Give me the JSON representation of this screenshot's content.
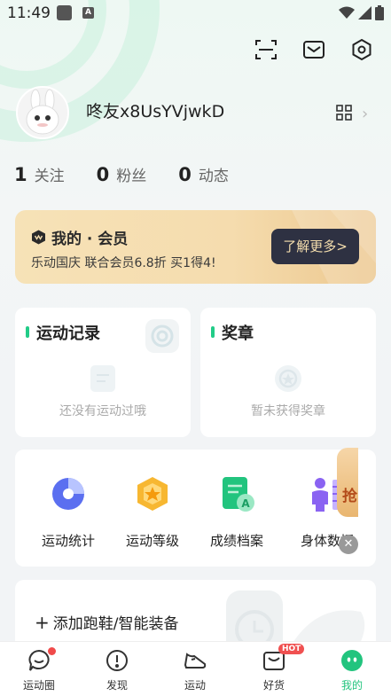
{
  "status_bar": {
    "time": "11:49",
    "a_badge": "A"
  },
  "top_icons": [
    "scan-icon",
    "mail-icon",
    "settings-icon"
  ],
  "profile": {
    "username": "咚友x8UsYVjwkD"
  },
  "stats": [
    {
      "value": "1",
      "label": "关注"
    },
    {
      "value": "0",
      "label": "粉丝"
    },
    {
      "value": "0",
      "label": "动态"
    }
  ],
  "vip": {
    "title": "我的 · 会员",
    "subtitle": "乐动国庆 联合会员6.8折 买1得4!",
    "button": "了解更多>"
  },
  "records": {
    "title": "运动记录",
    "empty": "还没有运动过哦"
  },
  "medals": {
    "title": "奖章",
    "empty": "暂未获得奖章"
  },
  "tools": [
    {
      "label": "运动统计",
      "icon": "stats-pie-icon"
    },
    {
      "label": "运动等级",
      "icon": "level-badge-icon"
    },
    {
      "label": "成绩档案",
      "icon": "record-file-icon"
    },
    {
      "label": "身体数据",
      "icon": "body-data-icon"
    }
  ],
  "grab_label": "抢",
  "device": {
    "label": "添加跑鞋/智能装备"
  },
  "tabs": [
    {
      "label": "运动圈",
      "icon": "chat-bubble-icon",
      "badge_dot": true
    },
    {
      "label": "发现",
      "icon": "compass-icon"
    },
    {
      "label": "运动",
      "icon": "shoe-icon"
    },
    {
      "label": "好货",
      "icon": "shop-icon",
      "badge": "HOT"
    },
    {
      "label": "我的",
      "icon": "me-face-icon",
      "active": true
    }
  ],
  "colors": {
    "accent": "#22c47e",
    "vip_button": "#2e3142",
    "hot": "#f05050"
  }
}
